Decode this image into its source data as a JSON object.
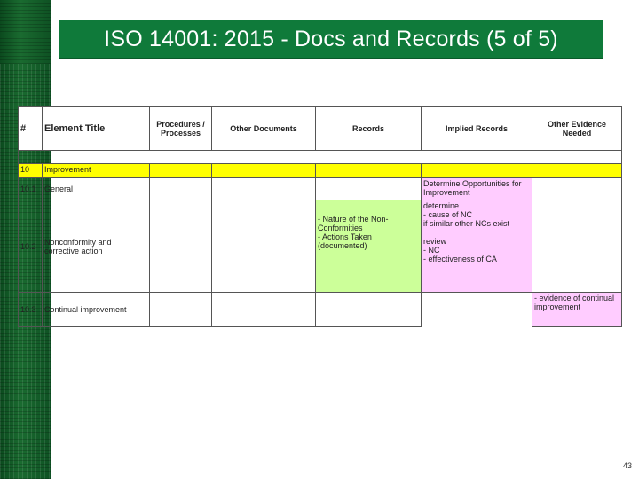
{
  "slide": {
    "title": "ISO 14001: 2015 - Docs and Records (5 of 5)",
    "page_number": "43"
  },
  "table": {
    "headers": [
      "#",
      "Element Title",
      "Procedures / Processes",
      "Other Documents",
      "Records",
      "Implied Records",
      "Other Evidence Needed"
    ],
    "rows": [
      {
        "num": "10",
        "title": "Improvement",
        "procedures": "",
        "other_docs": "",
        "records": "",
        "implied": "",
        "other_evidence": ""
      },
      {
        "num": "10.1",
        "title": "General",
        "procedures": "",
        "other_docs": "",
        "records": "",
        "implied": "Determine Opportunities for Improvement",
        "other_evidence": ""
      },
      {
        "num": "10.2",
        "title": "Nonconformity and corrective action",
        "procedures": "",
        "other_docs": "",
        "records": "- Nature of the Non-Conformities\n- Actions Taken (documented)",
        "implied": " determine\n- cause of NC\n  if similar other NCs exist\n\nreview\n- NC\n- effectiveness of CA",
        "other_evidence": ""
      },
      {
        "num": "10.3",
        "title": "Continual improvement",
        "procedures": "",
        "other_docs": "",
        "records": "",
        "implied": "",
        "other_evidence": "- evidence of continual improvement"
      }
    ]
  },
  "colors": {
    "title_bg": "#0f7a3a",
    "highlight_yellow": "#ffff00",
    "highlight_pink": "#ffccff",
    "highlight_green": "#ccff99"
  }
}
